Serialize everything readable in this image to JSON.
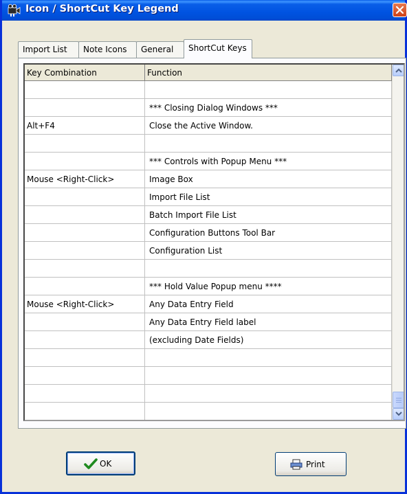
{
  "window": {
    "title": "Icon / ShortCut Key Legend",
    "title_icon": "film-reel-icon",
    "close_icon": "close-icon",
    "accent_color": "#0a5ee8"
  },
  "tabs": [
    {
      "label": "Import List",
      "active": false
    },
    {
      "label": "Note Icons",
      "active": false
    },
    {
      "label": "General",
      "active": false
    },
    {
      "label": "ShortCut Keys",
      "active": true
    }
  ],
  "grid": {
    "columns": [
      "Key Combination",
      "Function"
    ],
    "rows": [
      [
        "",
        ""
      ],
      [
        "",
        "*** Closing Dialog Windows ***"
      ],
      [
        "Alt+F4",
        "Close the Active Window."
      ],
      [
        "",
        ""
      ],
      [
        "",
        "*** Controls with Popup Menu ***"
      ],
      [
        "Mouse <Right-Click>",
        "Image Box"
      ],
      [
        "",
        "Import File List"
      ],
      [
        "",
        "Batch Import File List"
      ],
      [
        "",
        "Configuration Buttons Tool Bar"
      ],
      [
        "",
        "Configuration List"
      ],
      [
        "",
        ""
      ],
      [
        "",
        "*** Hold Value Popup menu ****"
      ],
      [
        "Mouse <Right-Click>",
        "Any Data Entry Field"
      ],
      [
        "",
        "Any Data Entry Field label"
      ],
      [
        "",
        "(excluding Date Fields)"
      ],
      [
        "",
        ""
      ],
      [
        "",
        ""
      ],
      [
        "",
        ""
      ],
      [
        "",
        ""
      ]
    ]
  },
  "buttons": {
    "ok_label": "OK",
    "ok_icon": "checkmark-icon",
    "print_label": "Print",
    "print_icon": "printer-icon"
  }
}
